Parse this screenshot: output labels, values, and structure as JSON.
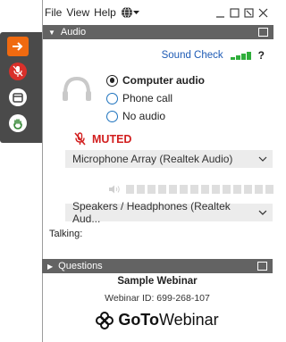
{
  "menu": {
    "file": "File",
    "view": "View",
    "help": "Help"
  },
  "audio_section": {
    "title": "Audio"
  },
  "sound_check": {
    "label": "Sound Check",
    "help": "?"
  },
  "audio_options": [
    {
      "label": "Computer audio",
      "selected": true
    },
    {
      "label": "Phone call",
      "selected": false
    },
    {
      "label": "No audio",
      "selected": false
    }
  ],
  "mute_status": "MUTED",
  "microphone": {
    "selected": "Microphone Array (Realtek Audio)"
  },
  "speakers": {
    "selected": "Speakers / Headphones (Realtek Aud..."
  },
  "talking_label": "Talking:",
  "questions_section": {
    "title": "Questions"
  },
  "webinar": {
    "title": "Sample Webinar",
    "id_text": "Webinar ID: 699-268-107"
  },
  "brand": {
    "goto": "GoTo",
    "product": "Webinar"
  },
  "colors": {
    "accent_orange": "#f06a10",
    "muted_red": "#d21f1f",
    "link_blue": "#1e5bb5",
    "signal_green": "#2fae3b",
    "header_gray": "#636363"
  }
}
